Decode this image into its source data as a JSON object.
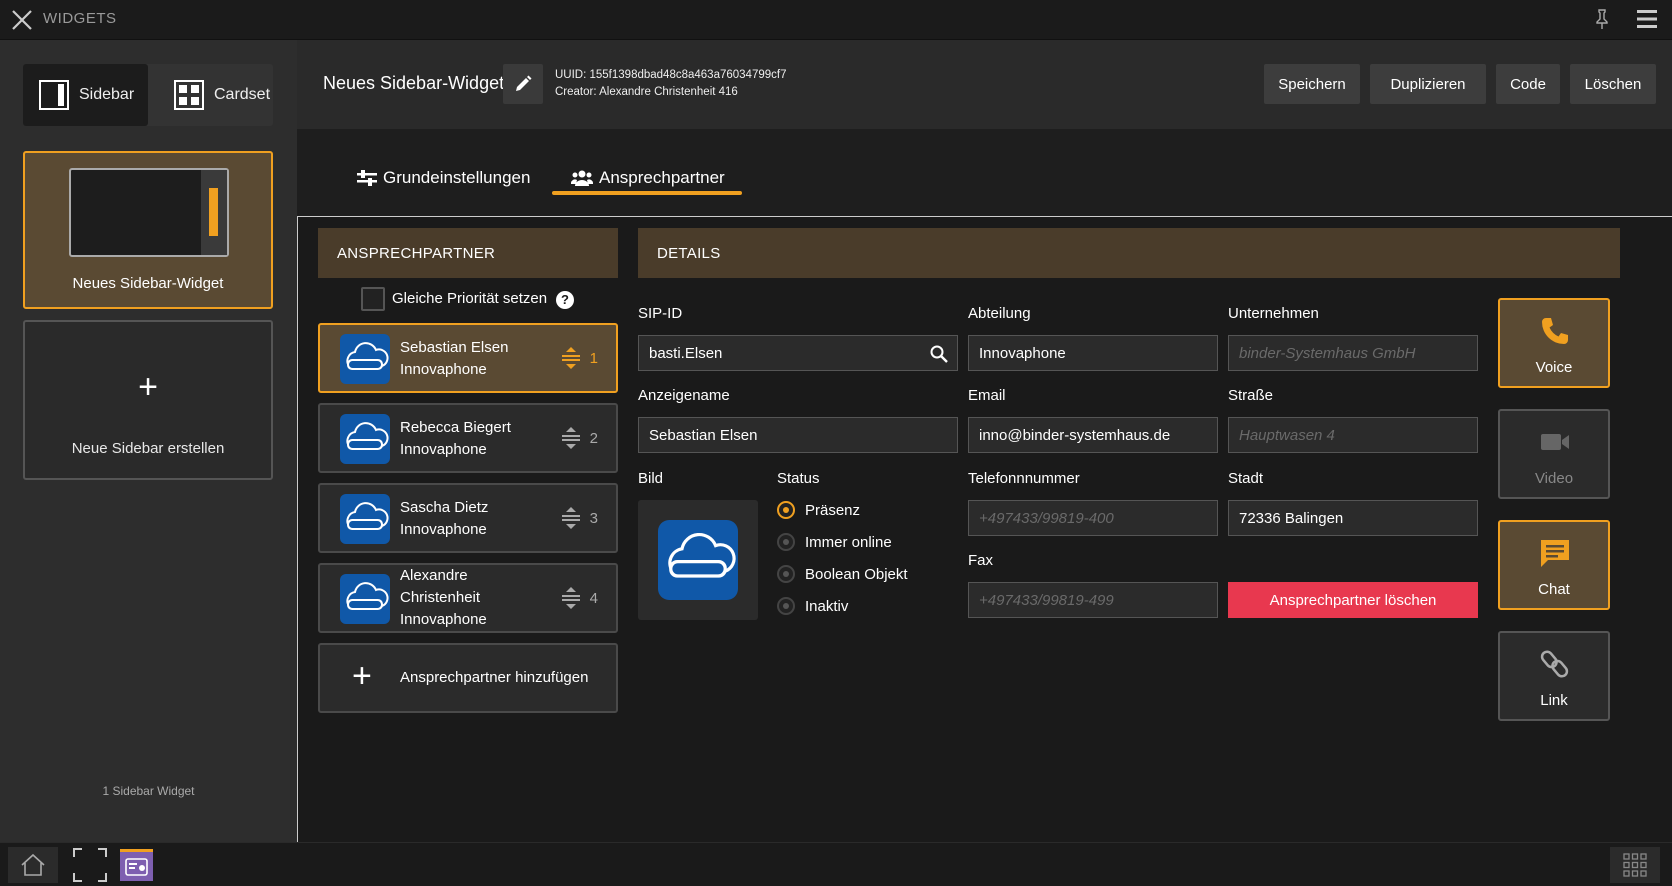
{
  "titlebar": {
    "title": "WIDGETS"
  },
  "switcher": {
    "sidebar_label": "Sidebar",
    "cardset_label": "Cardset"
  },
  "widget_card": {
    "label": "Neues Sidebar-Widget"
  },
  "new_sidebar": {
    "label": "Neue Sidebar erstellen"
  },
  "widget_count": "1 Sidebar Widget",
  "header": {
    "widget_name": "Neues Sidebar-Widget",
    "uuid": "UUID: 155f1398dbad48c8a463a76034799cf7",
    "creator": "Creator: Alexandre Christenheit 416",
    "buttons": {
      "save": "Speichern",
      "duplicate": "Duplizieren",
      "code": "Code",
      "delete": "Löschen"
    }
  },
  "tabs": {
    "basic": "Grundeinstellungen",
    "contacts": "Ansprechpartner"
  },
  "contacts_panel": {
    "heading": "ANSPRECHPARTNER",
    "same_priority": "Gleiche Priorität setzen",
    "help": "?",
    "items": [
      {
        "name": "Sebastian Elsen",
        "company": "Innovaphone",
        "priority": "1"
      },
      {
        "name": "Rebecca Biegert",
        "company": "Innovaphone",
        "priority": "2"
      },
      {
        "name": "Sascha Dietz",
        "company": "Innovaphone",
        "priority": "3"
      },
      {
        "name": "Alexandre",
        "name2": "Christenheit",
        "company": "Innovaphone",
        "priority": "4"
      }
    ],
    "add_label": "Ansprechpartner hinzufügen"
  },
  "details": {
    "heading": "DETAILS",
    "labels": {
      "sip": "SIP-ID",
      "department": "Abteilung",
      "company": "Unternehmen",
      "display_name": "Anzeigename",
      "email": "Email",
      "street": "Straße",
      "picture": "Bild",
      "status": "Status",
      "phone": "Telefonnnummer",
      "city": "Stadt",
      "fax": "Fax"
    },
    "values": {
      "sip": "basti.Elsen",
      "department": "Innovaphone",
      "display_name": "Sebastian Elsen",
      "email": "inno@binder-systemhaus.de",
      "city": "72336 Balingen"
    },
    "placeholders": {
      "company": "binder-Systemhaus GmbH",
      "street": "Hauptwasen 4",
      "phone": "+497433/99819-400",
      "fax": "+497433/99819-499"
    },
    "status_options": [
      "Präsenz",
      "Immer online",
      "Boolean Objekt",
      "Inaktiv"
    ],
    "delete_label": "Ansprechpartner löschen"
  },
  "actions": {
    "voice": "Voice",
    "video": "Video",
    "chat": "Chat",
    "link": "Link"
  },
  "colors": {
    "accent": "#f0a020",
    "danger": "#e8384f",
    "active_bg": "#5a4a33"
  }
}
